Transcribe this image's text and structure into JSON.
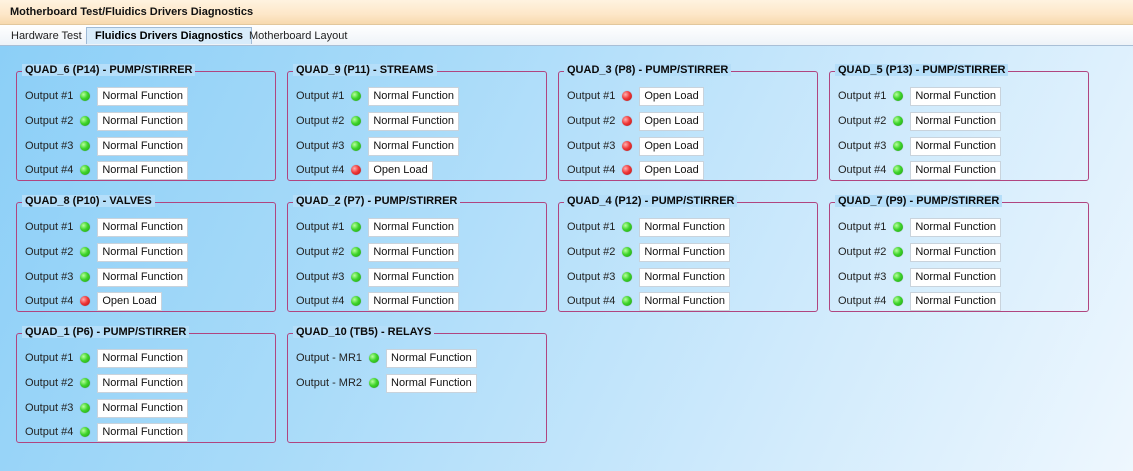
{
  "window": {
    "title": "Motherboard Test/Fluidics Drivers Diagnostics"
  },
  "tabs": [
    {
      "label": "Hardware Test",
      "active": false
    },
    {
      "label": "Fluidics Drivers Diagnostics",
      "active": true
    },
    {
      "label": "Motherboard Layout",
      "active": false
    }
  ],
  "colors": {
    "ok": "#3ed42a",
    "fault": "#f03838",
    "group_border": "#b0457f"
  },
  "groups": [
    {
      "title": "QUAD_6 (P14) - PUMP/STIRRER",
      "outputs": [
        {
          "label": "Output #1",
          "status": "Normal Function",
          "state": "ok"
        },
        {
          "label": "Output #2",
          "status": "Normal Function",
          "state": "ok"
        },
        {
          "label": "Output #3",
          "status": "Normal Function",
          "state": "ok"
        },
        {
          "label": "Output #4",
          "status": "Normal Function",
          "state": "ok"
        }
      ]
    },
    {
      "title": "QUAD_9 (P11) - STREAMS",
      "outputs": [
        {
          "label": "Output #1",
          "status": "Normal Function",
          "state": "ok"
        },
        {
          "label": "Output #2",
          "status": "Normal Function",
          "state": "ok"
        },
        {
          "label": "Output #3",
          "status": "Normal Function",
          "state": "ok"
        },
        {
          "label": "Output #4",
          "status": "Open Load",
          "state": "fault"
        }
      ]
    },
    {
      "title": "QUAD_3 (P8) - PUMP/STIRRER",
      "outputs": [
        {
          "label": "Output #1",
          "status": "Open Load",
          "state": "fault"
        },
        {
          "label": "Output #2",
          "status": "Open Load",
          "state": "fault"
        },
        {
          "label": "Output #3",
          "status": "Open Load",
          "state": "fault"
        },
        {
          "label": "Output #4",
          "status": "Open Load",
          "state": "fault"
        }
      ]
    },
    {
      "title": "QUAD_5 (P13) - PUMP/STIRRER",
      "outputs": [
        {
          "label": "Output #1",
          "status": "Normal Function",
          "state": "ok"
        },
        {
          "label": "Output #2",
          "status": "Normal Function",
          "state": "ok"
        },
        {
          "label": "Output #3",
          "status": "Normal Function",
          "state": "ok"
        },
        {
          "label": "Output #4",
          "status": "Normal Function",
          "state": "ok"
        }
      ]
    },
    {
      "title": "QUAD_8 (P10) - VALVES",
      "outputs": [
        {
          "label": "Output #1",
          "status": "Normal Function",
          "state": "ok"
        },
        {
          "label": "Output #2",
          "status": "Normal Function",
          "state": "ok"
        },
        {
          "label": "Output #3",
          "status": "Normal Function",
          "state": "ok"
        },
        {
          "label": "Output #4",
          "status": "Open Load",
          "state": "fault"
        }
      ]
    },
    {
      "title": "QUAD_2 (P7) - PUMP/STIRRER",
      "outputs": [
        {
          "label": "Output #1",
          "status": "Normal Function",
          "state": "ok"
        },
        {
          "label": "Output #2",
          "status": "Normal Function",
          "state": "ok"
        },
        {
          "label": "Output #3",
          "status": "Normal Function",
          "state": "ok"
        },
        {
          "label": "Output #4",
          "status": "Normal Function",
          "state": "ok"
        }
      ]
    },
    {
      "title": "QUAD_4 (P12) - PUMP/STIRRER",
      "outputs": [
        {
          "label": "Output #1",
          "status": "Normal Function",
          "state": "ok"
        },
        {
          "label": "Output #2",
          "status": "Normal Function",
          "state": "ok"
        },
        {
          "label": "Output #3",
          "status": "Normal Function",
          "state": "ok"
        },
        {
          "label": "Output #4",
          "status": "Normal Function",
          "state": "ok"
        }
      ]
    },
    {
      "title": "QUAD_7 (P9) - PUMP/STIRRER",
      "outputs": [
        {
          "label": "Output #1",
          "status": "Normal Function",
          "state": "ok"
        },
        {
          "label": "Output #2",
          "status": "Normal Function",
          "state": "ok"
        },
        {
          "label": "Output #3",
          "status": "Normal Function",
          "state": "ok"
        },
        {
          "label": "Output #4",
          "status": "Normal Function",
          "state": "ok"
        }
      ]
    },
    {
      "title": "QUAD_1 (P6) - PUMP/STIRRER",
      "outputs": [
        {
          "label": "Output #1",
          "status": "Normal Function",
          "state": "ok"
        },
        {
          "label": "Output #2",
          "status": "Normal Function",
          "state": "ok"
        },
        {
          "label": "Output #3",
          "status": "Normal Function",
          "state": "ok"
        },
        {
          "label": "Output #4",
          "status": "Normal Function",
          "state": "ok"
        }
      ]
    },
    {
      "title": "QUAD_10 (TB5) - RELAYS",
      "outputs": [
        {
          "label": "Output - MR1",
          "status": "Normal Function",
          "state": "ok"
        },
        {
          "label": "Output - MR2",
          "status": "Normal Function",
          "state": "ok"
        }
      ]
    }
  ]
}
